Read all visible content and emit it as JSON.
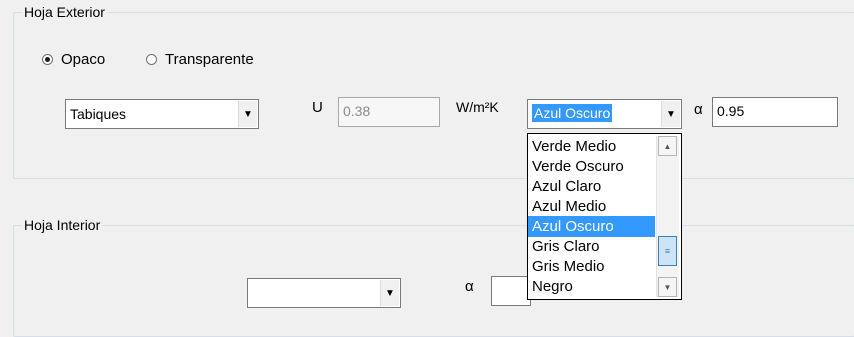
{
  "hoja_exterior": {
    "title": "Hoja Exterior",
    "radio_opaco": "Opaco",
    "radio_transparente": "Transparente",
    "selected_radio": "Opaco",
    "material_combo": "Tabiques",
    "u_label": "U",
    "u_value": "0.38",
    "u_unit": "W/m²K",
    "color_combo": "Azul Oscuro",
    "alpha_label": "α",
    "alpha_value": "0.95"
  },
  "color_dropdown": {
    "options": [
      "Verde Medio",
      "Verde Oscuro",
      "Azul Claro",
      "Azul Medio",
      "Azul Oscuro",
      "Gris Claro",
      "Gris Medio",
      "Negro"
    ],
    "selected": "Azul Oscuro"
  },
  "hoja_interior": {
    "title": "Hoja Interior",
    "color_combo": "",
    "alpha_label": "α",
    "alpha_value": ""
  },
  "icons": {
    "combo_arrow": "chevron-down-icon",
    "scroll_up": "scroll-up-icon",
    "scroll_down": "scroll-down-icon"
  }
}
